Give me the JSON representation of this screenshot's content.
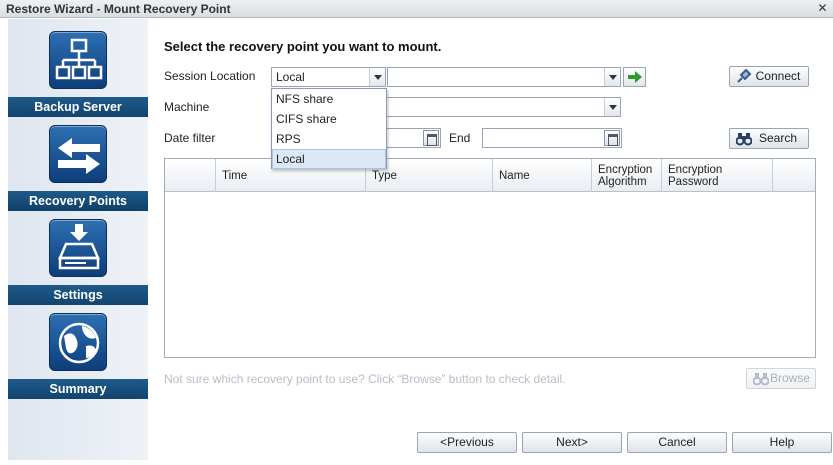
{
  "window": {
    "title": "Restore Wizard - Mount Recovery Point",
    "close_glyph": "✕"
  },
  "sidebar": {
    "steps": [
      {
        "label": "Backup Server",
        "icon": "network-server-icon"
      },
      {
        "label": "Recovery Points",
        "icon": "exchange-arrows-icon"
      },
      {
        "label": "Settings",
        "icon": "drive-download-icon"
      },
      {
        "label": "Summary",
        "icon": "globe-icon"
      }
    ]
  },
  "main": {
    "heading": "Select the recovery point you want to mount.",
    "session_location": {
      "label": "Session Location",
      "selected": "Local",
      "path_value": "",
      "options": [
        "NFS share",
        "CIFS share",
        "RPS",
        "Local"
      ],
      "highlighted_option": "Local"
    },
    "connect_label": "Connect",
    "machine": {
      "label": "Machine",
      "value": ""
    },
    "date_filter": {
      "label": "Date filter",
      "start": "",
      "end_label": "End",
      "end": ""
    },
    "search_label": "Search",
    "table": {
      "columns": [
        "",
        "Time",
        "Type",
        "Name",
        "Encryption Algorithm",
        "Encryption Password"
      ],
      "rows": []
    },
    "hint": "Not sure which recovery point to use? Click “Browse” button to check detail.",
    "browse_label": "Browse"
  },
  "footer": {
    "previous_label": "<Previous",
    "next_label": "Next>",
    "cancel_label": "Cancel",
    "help_label": "Help"
  },
  "colors": {
    "sidebar_label_bg": "#1e5a8a",
    "icon_bg": "#1a5497",
    "go_arrow": "#2e9b2e"
  }
}
